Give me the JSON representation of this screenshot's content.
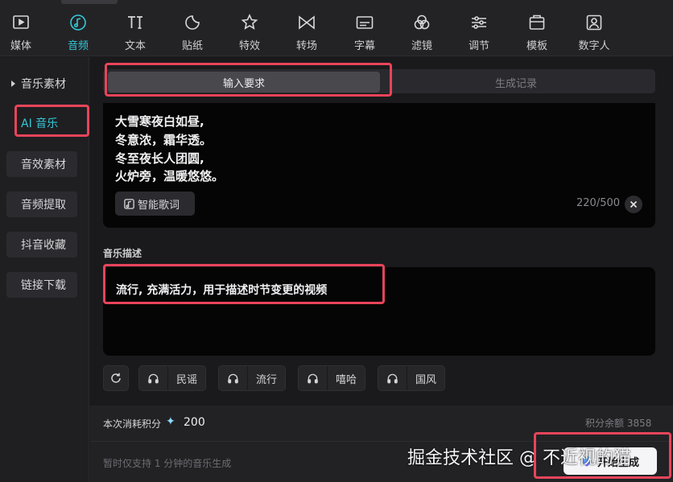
{
  "toolbar": {
    "items": [
      {
        "label": "媒体",
        "icon": "media-icon"
      },
      {
        "label": "音频",
        "icon": "audio-icon"
      },
      {
        "label": "文本",
        "icon": "text-icon"
      },
      {
        "label": "贴纸",
        "icon": "sticker-icon"
      },
      {
        "label": "特效",
        "icon": "effects-icon"
      },
      {
        "label": "转场",
        "icon": "transition-icon"
      },
      {
        "label": "字幕",
        "icon": "subtitle-icon"
      },
      {
        "label": "滤镜",
        "icon": "filter-icon"
      },
      {
        "label": "调节",
        "icon": "adjust-icon"
      },
      {
        "label": "模板",
        "icon": "template-icon"
      },
      {
        "label": "数字人",
        "icon": "digital-human-icon"
      }
    ],
    "active": "音频"
  },
  "sidebar": {
    "items": [
      {
        "label": "音乐素材"
      },
      {
        "label": "AI 音乐"
      },
      {
        "label": "音效素材"
      },
      {
        "label": "音频提取"
      },
      {
        "label": "抖音收藏"
      },
      {
        "label": "链接下载"
      }
    ],
    "active": "AI 音乐"
  },
  "tabs": {
    "input": "输入要求",
    "history": "生成记录"
  },
  "lyrics": {
    "lines": [
      "大雪寒夜白如昼,",
      "冬意浓，霜华透。",
      "冬至夜长人团圆,",
      "火炉旁，温暖悠悠。"
    ],
    "smart_button": "智能歌词",
    "counter": "220/500"
  },
  "description": {
    "label": "音乐描述",
    "text": "流行, 充满活力，用于描述时节变更的视频"
  },
  "style_chips": [
    "民谣",
    "流行",
    "嘻哈",
    "国风"
  ],
  "footer": {
    "cost_label": "本次消耗积分",
    "cost_value": "200",
    "balance": "积分余额 3858",
    "hint": "暂时仅支持 1 分钟的音乐生成",
    "generate": "开始生成"
  },
  "watermark": "掘金技术社区 @ 不近视的猫",
  "colors": {
    "accent": "#35c8d8",
    "highlight": "#e8445a",
    "background": "#1a1a1c"
  }
}
